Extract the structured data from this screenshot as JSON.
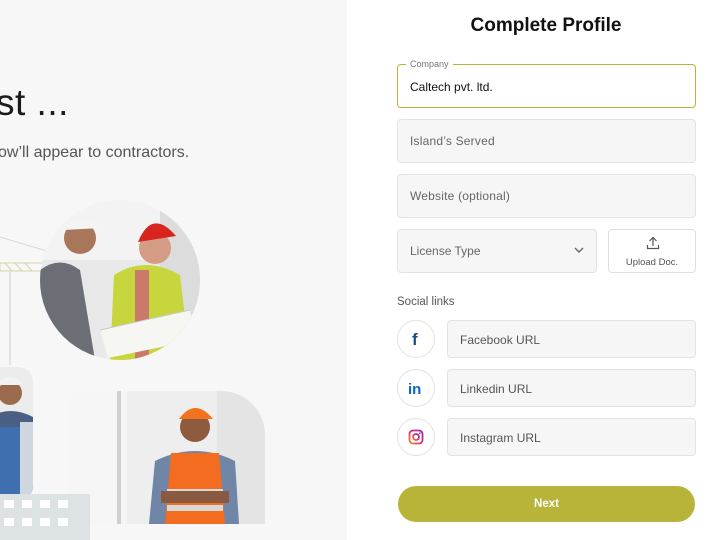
{
  "hero": {
    "title": "st ...",
    "subtitle": "ow’ll appear to contractors."
  },
  "form": {
    "title": "Complete Profile",
    "company": {
      "label": "Company",
      "value": "Caltech pvt. ltd."
    },
    "islands": {
      "placeholder": "Island’s Served"
    },
    "website": {
      "placeholder": "Website (optional)"
    },
    "license": {
      "placeholder": "License Type"
    },
    "upload": {
      "label": "Upload Doc."
    },
    "social_title": "Social links",
    "facebook": {
      "placeholder": "Facebook URL",
      "icon": "facebook-icon"
    },
    "linkedin": {
      "placeholder": "Linkedin URL",
      "icon": "linkedin-icon"
    },
    "instagram": {
      "placeholder": "Instagram URL",
      "icon": "instagram-icon"
    },
    "next_label": "Next"
  },
  "colors": {
    "accent": "#b8b43a",
    "left_bg": "#f7f7f7",
    "facebook": "#3b5998",
    "linkedin": "#0a66c2",
    "instagram": "#d6249f"
  }
}
